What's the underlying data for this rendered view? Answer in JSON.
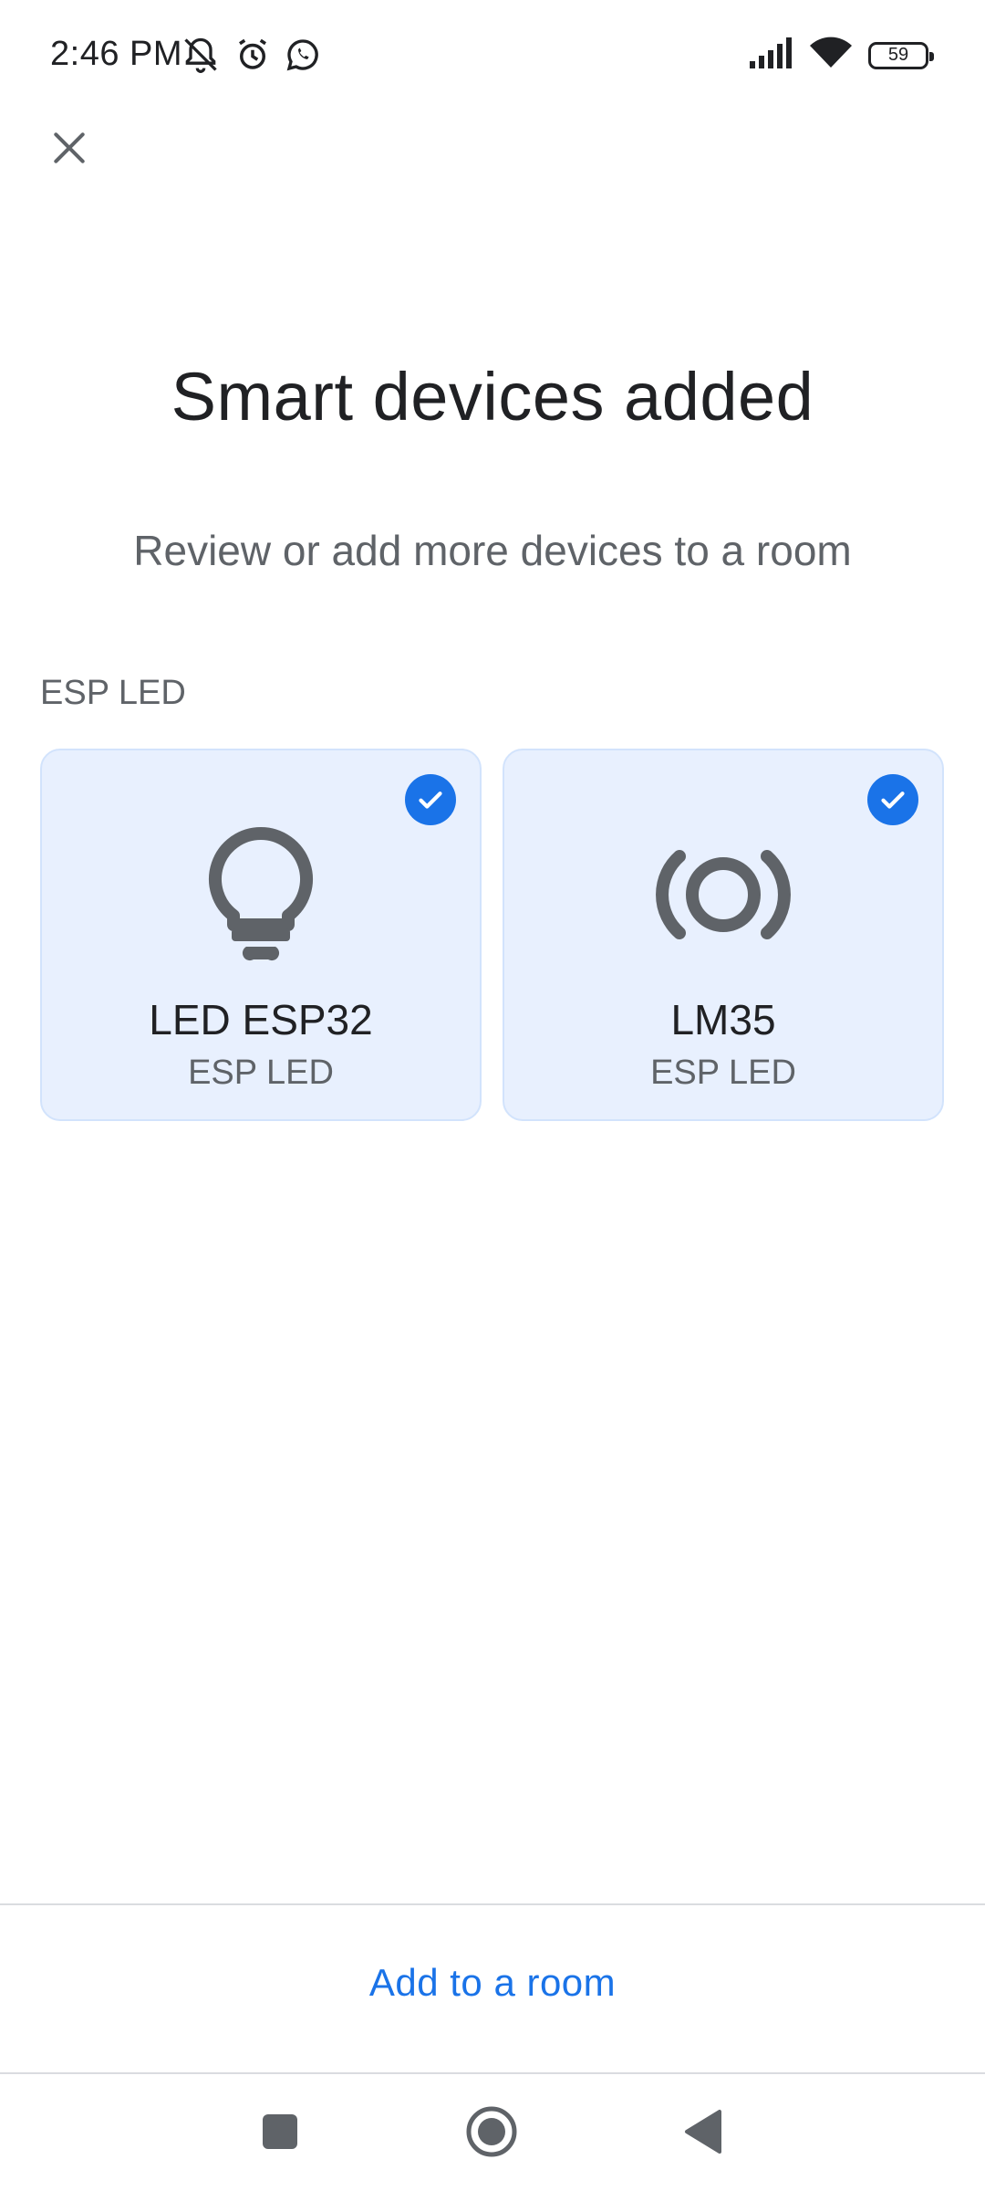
{
  "status_bar": {
    "time": "2:46 PM",
    "battery_level": "59",
    "icons": [
      "mute-bell-icon",
      "alarm-icon",
      "whatsapp-icon",
      "signal-icon",
      "wifi-icon",
      "battery-icon"
    ]
  },
  "header": {
    "close_icon": "close-icon"
  },
  "main": {
    "title": "Smart devices added",
    "subtitle": "Review or add more devices to a room",
    "section_label": "ESP LED",
    "devices": [
      {
        "name": "LED ESP32",
        "room": "ESP LED",
        "icon": "lightbulb-icon",
        "selected": true
      },
      {
        "name": "LM35",
        "room": "ESP LED",
        "icon": "sensor-icon",
        "selected": true
      }
    ]
  },
  "footer": {
    "add_to_room_label": "Add to a room"
  },
  "nav": {
    "icons": [
      "recents-icon",
      "home-icon",
      "back-icon"
    ]
  },
  "colors": {
    "accent": "#1a73e8",
    "card_bg": "#e8f0fe",
    "icon_gray": "#5f6368"
  }
}
